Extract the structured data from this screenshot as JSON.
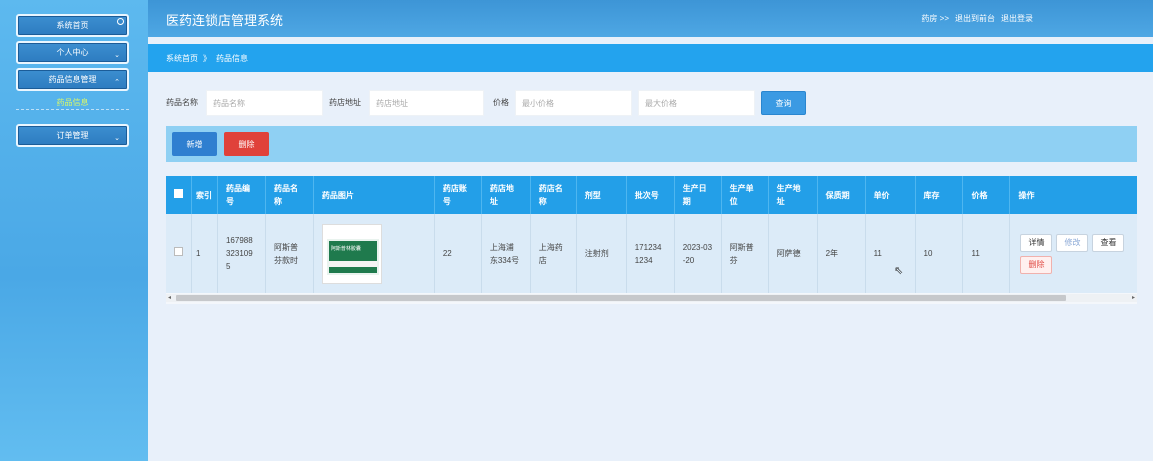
{
  "sidebar": {
    "items": [
      {
        "label": "系统首页"
      },
      {
        "label": "个人中心"
      },
      {
        "label": "药品信息管理"
      },
      {
        "label": "订单管理"
      }
    ],
    "sub_item": "药品信息"
  },
  "header": {
    "title": "医药连锁店管理系统",
    "user": "药房 >>",
    "exit_to_front": "退出到前台",
    "logout": "退出登录"
  },
  "breadcrumb": {
    "home": "系统首页",
    "separator": "》",
    "current": "药品信息"
  },
  "search": {
    "name_label": "药品名称",
    "name_placeholder": "药品名称",
    "addr_label": "药店地址",
    "addr_placeholder": "药店地址",
    "price_label": "价格",
    "min_placeholder": "最小价格",
    "max_placeholder": "最大价格",
    "query_label": "查询"
  },
  "actions": {
    "add_label": "新增",
    "delete_label": "删除"
  },
  "table": {
    "headers": [
      "索引",
      "药品编号",
      "药品名称",
      "药品图片",
      "药店账号",
      "药店地址",
      "药店名称",
      "剂型",
      "批次号",
      "生产日期",
      "生产单位",
      "生产地址",
      "保质期",
      "单价",
      "库存",
      "价格",
      "操作"
    ],
    "rows": [
      {
        "index": "1",
        "code": "1679883231095",
        "name": "阿斯普芬款时",
        "image_text": "阿斯普林胶囊",
        "store_account": "22",
        "store_address": "上海浦东334号",
        "store_name": "上海药店",
        "dosage_form": "注射剂",
        "batch": "1712341234",
        "prod_date": "2023-03-20",
        "manufacturer": "阿斯普芬",
        "prod_address": "阿萨德",
        "shelf_life": "2年",
        "unit_price": "11",
        "stock": "10",
        "price": "11",
        "ops": {
          "detail": "详情",
          "edit": "修改",
          "view": "查看",
          "delete": "删除"
        }
      }
    ]
  },
  "colors": {
    "header_bg": "#3d95d6",
    "crumb_bg": "#23a3ee",
    "table_head_bg": "#239fe8",
    "add_btn": "#2f7fd0",
    "delete_btn": "#e0413a"
  }
}
